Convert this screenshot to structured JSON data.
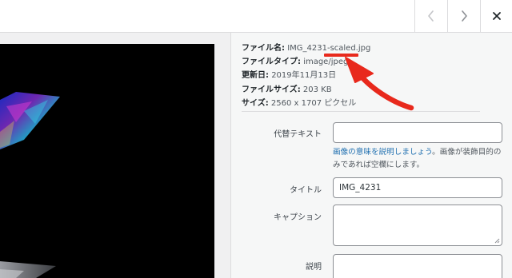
{
  "navigation": {
    "prev_icon": "chevron-left-icon",
    "next_icon": "chevron-right-icon",
    "close_icon": "close-icon"
  },
  "file_info": {
    "filename_label": "ファイル名:",
    "filename_value": "IMG_4231-scaled.jpg",
    "filetype_label": "ファイルタイプ:",
    "filetype_value": "image/jpeg",
    "updated_label": "更新日:",
    "updated_value": "2019年11月13日",
    "filesize_label": "ファイルサイズ:",
    "filesize_value": "203 KB",
    "dimensions_label": "サイズ:",
    "dimensions_value": "2560 x 1707 ピクセル"
  },
  "form": {
    "alt_label": "代替テキスト",
    "alt_value": "",
    "alt_help_link": "画像の意味を説明しましょう",
    "alt_help_rest": "。画像が装飾目的のみであれば空欄にします。",
    "title_label": "タイトル",
    "title_value": "IMG_4231",
    "caption_label": "キャプション",
    "caption_value": "",
    "description_label": "説明",
    "description_value": ""
  },
  "colors": {
    "annotation": "#e8291c",
    "link": "#2271b1",
    "border": "#dcdcde"
  }
}
